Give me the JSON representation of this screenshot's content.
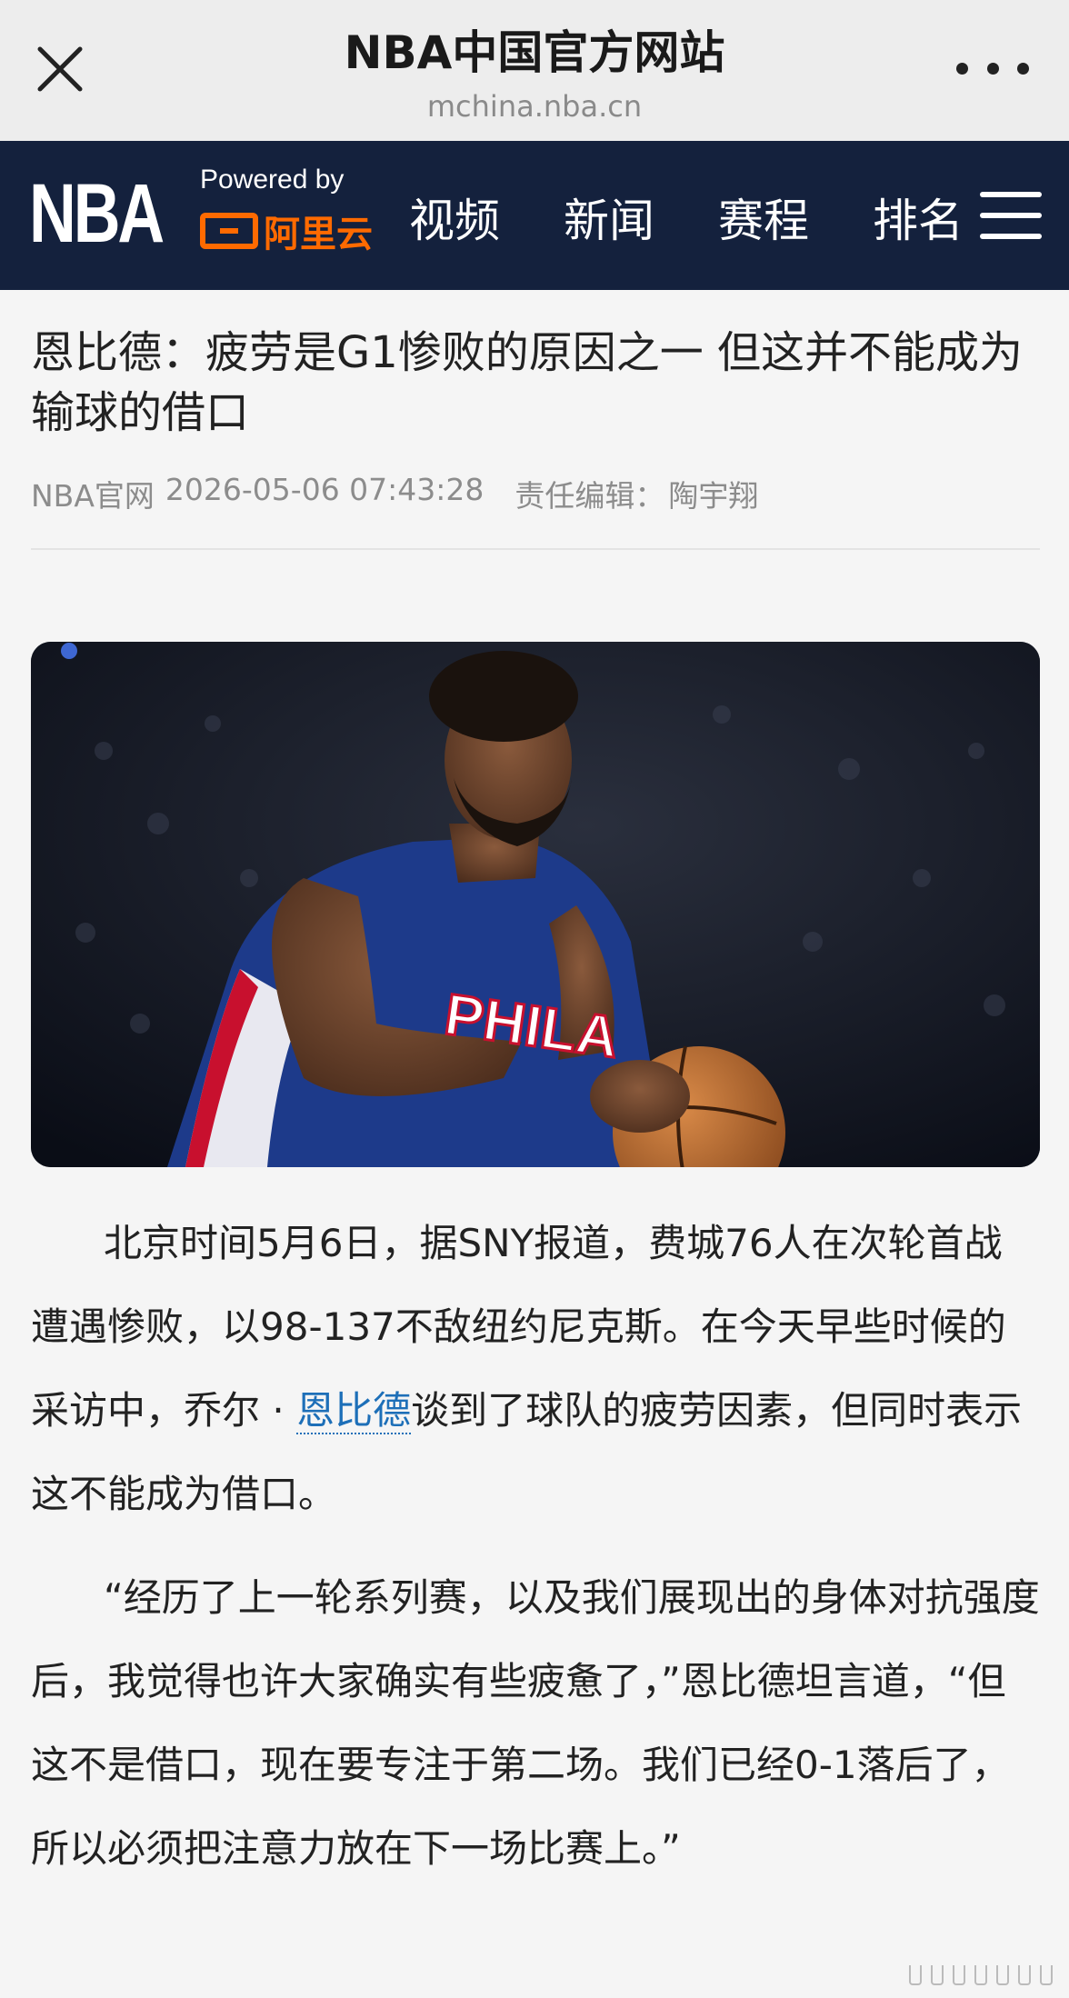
{
  "webview": {
    "title": "NBA中国官方网站",
    "url": "mchina.nba.cn"
  },
  "nav": {
    "logo_text": "NBA",
    "powered_by": "Powered by",
    "sponsor": "阿里云",
    "items": [
      "视频",
      "新闻",
      "赛程",
      "排名"
    ]
  },
  "article": {
    "title": "恩比德：疲劳是G1惨败的原因之一 但这并不能成为输球的借口",
    "source": "NBA官网",
    "datetime": "2026-05-06 07:43:28",
    "editor_label": "责任编辑：",
    "editor": "陶宇翔",
    "para1_a": "北京时间5月6日，据SNY报道，费城76人在次轮首战遭遇惨败，以98-137不敌纽约尼克斯。在今天早些时候的采访中，乔尔 · ",
    "para1_link": "恩比德",
    "para1_b": "谈到了球队的疲劳因素，但同时表示这不能成为借口。",
    "para2": "“经历了上一轮系列赛，以及我们展现出的身体对抗强度后，我觉得也许大家确实有些疲惫了，”恩比德坦言道，“但这不是借口，现在要专注于第二场。我们已经0-1落后了，所以必须把注意力放在下一场比赛上。”"
  },
  "photo": {
    "jersey_text": "PHILA"
  },
  "colors": {
    "nav_bg": "#14213d",
    "accent_orange": "#ff6a00",
    "link_blue": "#1d6fb8"
  }
}
